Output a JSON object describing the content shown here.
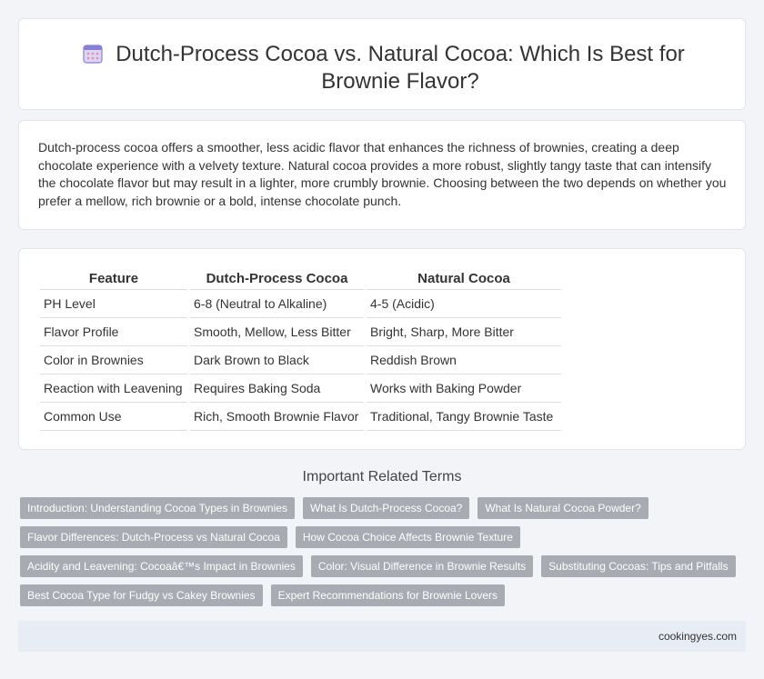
{
  "header": {
    "icon": "calendar-icon",
    "title": "Dutch-Process Cocoa vs. Natural Cocoa: Which Is Best for Brownie Flavor?"
  },
  "intro": "Dutch-process cocoa offers a smoother, less acidic flavor that enhances the richness of brownies, creating a deep chocolate experience with a velvety texture. Natural cocoa provides a more robust, slightly tangy taste that can intensify the chocolate flavor but may result in a lighter, more crumbly brownie. Choosing between the two depends on whether you prefer a mellow, rich brownie or a bold, intense chocolate punch.",
  "table": {
    "headers": [
      "Feature",
      "Dutch-Process Cocoa",
      "Natural Cocoa"
    ],
    "rows": [
      [
        "PH Level",
        "6-8 (Neutral to Alkaline)",
        "4-5 (Acidic)"
      ],
      [
        "Flavor Profile",
        "Smooth, Mellow, Less Bitter",
        "Bright, Sharp, More Bitter"
      ],
      [
        "Color in Brownies",
        "Dark Brown to Black",
        "Reddish Brown"
      ],
      [
        "Reaction with Leavening",
        "Requires Baking Soda",
        "Works with Baking Powder"
      ],
      [
        "Common Use",
        "Rich, Smooth Brownie Flavor",
        "Traditional, Tangy Brownie Taste"
      ]
    ]
  },
  "terms": {
    "title": "Important Related Terms",
    "items": [
      "Introduction: Understanding Cocoa Types in Brownies",
      "What Is Dutch-Process Cocoa?",
      "What Is Natural Cocoa Powder?",
      "Flavor Differences: Dutch-Process vs Natural Cocoa",
      "How Cocoa Choice Affects Brownie Texture",
      "Acidity and Leavening: Cocoaâ€™s Impact in Brownies",
      "Color: Visual Difference in Brownie Results",
      "Substituting Cocoas: Tips and Pitfalls",
      "Best Cocoa Type for Fudgy vs Cakey Brownies",
      "Expert Recommendations for Brownie Lovers"
    ]
  },
  "footer": {
    "site": "cookingyes.com"
  },
  "colors": {
    "tag_bg": "#a9abb2",
    "footer_bg": "#e8ecf4",
    "page_bg": "#f3f4f7"
  }
}
